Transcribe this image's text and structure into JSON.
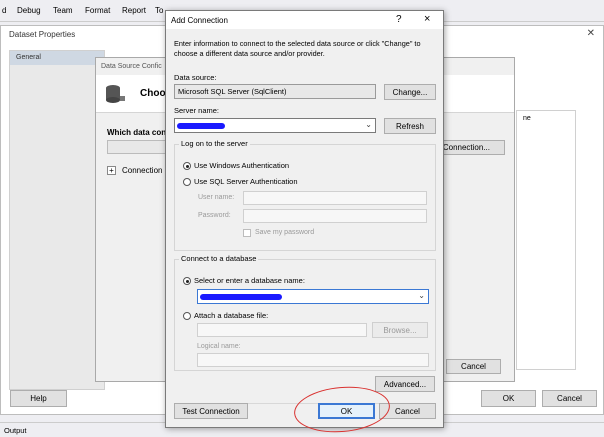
{
  "menubar": {
    "items": [
      "d",
      "Debug",
      "Team",
      "Format",
      "Report",
      "To"
    ]
  },
  "dataset_properties": {
    "title": "Dataset Properties",
    "nav_items": [
      "General"
    ],
    "help_button": "Help",
    "ok_button": "OK",
    "cancel_button": "Cancel"
  },
  "data_source_config": {
    "title": "Data Source Confic",
    "heading": "Choo",
    "which_label": "Which data conn",
    "connection_label": "Connection",
    "new_connection_button": "Connection...",
    "cancel_button": "Cancel",
    "list_header": "ne"
  },
  "output_tab": "Output",
  "dialog": {
    "title": "Add Connection",
    "help_glyph": "?",
    "close_glyph": "×",
    "intro": "Enter information to connect to the selected data source or click \"Change\" to choose a different data source and/or provider.",
    "data_source_label": "Data source:",
    "data_source_value": "Microsoft SQL Server (SqlClient)",
    "change_button": "Change...",
    "server_name_label": "Server name:",
    "refresh_button": "Refresh",
    "logon_group": "Log on to the server",
    "windows_auth": "Use Windows Authentication",
    "sql_auth": "Use SQL Server Authentication",
    "user_name_label": "User name:",
    "password_label": "Password:",
    "save_password": "Save my password",
    "db_group": "Connect to a database",
    "select_db": "Select or enter a database name:",
    "attach_db": "Attach a database file:",
    "browse_button": "Browse...",
    "logical_name_label": "Logical name:",
    "advanced_button": "Advanced...",
    "test_button": "Test Connection",
    "ok_button": "OK",
    "cancel_button": "Cancel"
  },
  "colors": {
    "redaction": "#1a1aff",
    "annotation": "#d9312f",
    "focus_border": "#3b78d4"
  }
}
